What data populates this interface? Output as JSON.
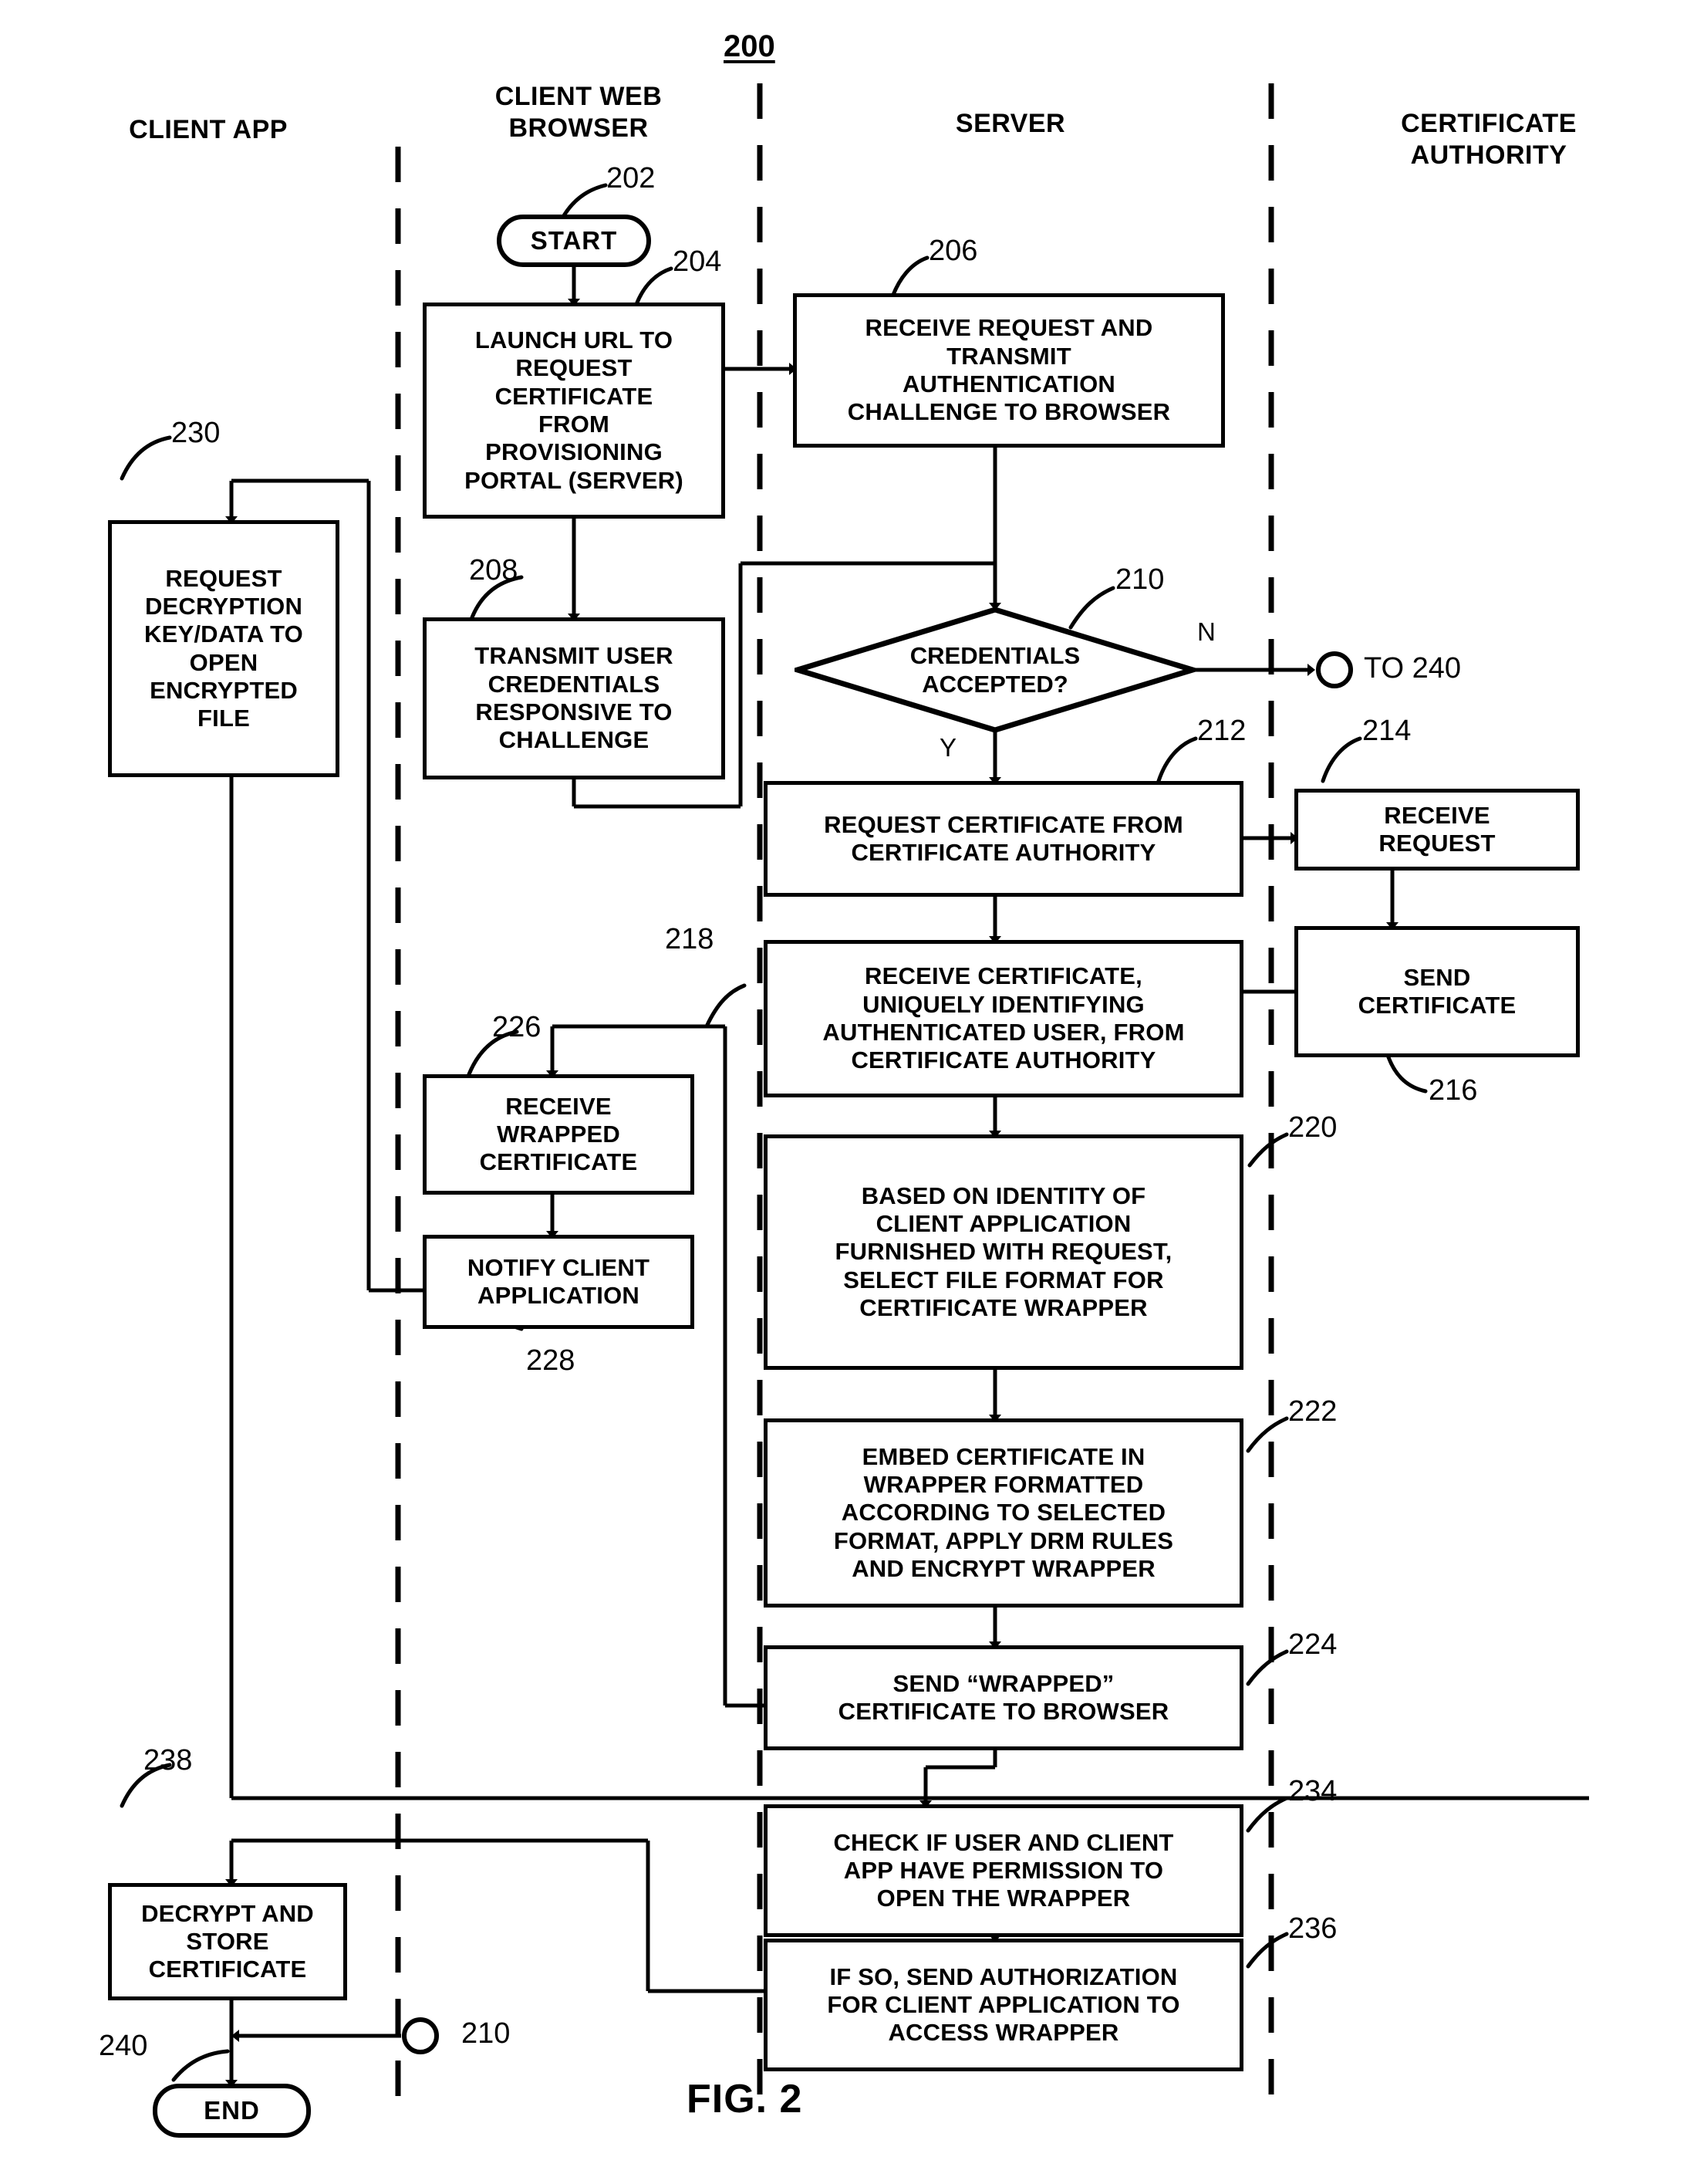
{
  "figure": {
    "number": "200",
    "caption": "FIG. 2"
  },
  "lanes": [
    {
      "id": "client-app",
      "label": "CLIENT APP"
    },
    {
      "id": "client-web-browser",
      "label": "CLIENT WEB\nBROWSER"
    },
    {
      "id": "server",
      "label": "SERVER"
    },
    {
      "id": "certificate-authority",
      "label": "CERTIFICATE\nAUTHORITY"
    }
  ],
  "lane_labels": {
    "client_app": "CLIENT APP",
    "client_web_browser_l1": "CLIENT WEB",
    "client_web_browser_l2": "BROWSER",
    "server": "SERVER",
    "certificate_authority_l1": "CERTIFICATE",
    "certificate_authority_l2": "AUTHORITY"
  },
  "nodes": {
    "n202": {
      "ref": "202",
      "type": "terminator",
      "text": "START",
      "lane": "client-web-browser"
    },
    "n204": {
      "ref": "204",
      "type": "process",
      "text": "LAUNCH URL TO REQUEST CERTIFICATE FROM PROVISIONING PORTAL (SERVER)",
      "lane": "client-web-browser"
    },
    "n206": {
      "ref": "206",
      "type": "process",
      "text": "RECEIVE REQUEST  AND TRANSMIT AUTHENTICATION CHALLENGE TO BROWSER",
      "lane": "server"
    },
    "n208": {
      "ref": "208",
      "type": "process",
      "text": "TRANSMIT USER CREDENTIALS RESPONSIVE TO CHALLENGE",
      "lane": "client-web-browser"
    },
    "n210": {
      "ref": "210",
      "type": "decision",
      "text": "CREDENTIALS ACCEPTED?",
      "lane": "server",
      "yes_label": "Y",
      "no_label": "N"
    },
    "n212": {
      "ref": "212",
      "type": "process",
      "text": "REQUEST CERTIFICATE FROM CERTIFICATE AUTHORITY",
      "lane": "server"
    },
    "n214": {
      "ref": "214",
      "type": "process",
      "text": "RECEIVE REQUEST",
      "lane": "certificate-authority"
    },
    "n216": {
      "ref": "216",
      "type": "process",
      "text": "SEND CERTIFICATE",
      "lane": "certificate-authority"
    },
    "n218": {
      "ref": "218",
      "type": "process",
      "text": "RECEIVE CERTIFICATE, UNIQUELY IDENTIFYING AUTHENTICATED USER, FROM CERTIFICATE AUTHORITY",
      "lane": "server"
    },
    "n220": {
      "ref": "220",
      "type": "process",
      "text": "BASED ON IDENTITY OF CLIENT APPLICATION FURNISHED WITH REQUEST, SELECT FILE FORMAT FOR CERTIFICATE WRAPPER",
      "lane": "server"
    },
    "n222": {
      "ref": "222",
      "type": "process",
      "text": "EMBED CERTIFICATE IN WRAPPER FORMATTED ACCORDING TO SELECTED FORMAT, APPLY DRM RULES AND ENCRYPT WRAPPER",
      "lane": "server"
    },
    "n224": {
      "ref": "224",
      "type": "process",
      "text": "SEND “WRAPPED” CERTIFICATE TO BROWSER",
      "lane": "server"
    },
    "n226": {
      "ref": "226",
      "type": "process",
      "text": "RECEIVE WRAPPED CERTIFICATE",
      "lane": "client-web-browser"
    },
    "n228": {
      "ref": "228",
      "type": "process",
      "text": "NOTIFY CLIENT APPLICATION",
      "lane": "client-web-browser"
    },
    "n230": {
      "ref": "230",
      "type": "process",
      "text": "REQUEST DECRYPTION KEY/DATA TO OPEN ENCRYPTED FILE",
      "lane": "client-app"
    },
    "n234": {
      "ref": "234",
      "type": "process",
      "text": "CHECK IF USER AND CLIENT APP HAVE PERMISSION TO OPEN THE WRAPPER",
      "lane": "server"
    },
    "n236": {
      "ref": "236",
      "type": "process",
      "text": "IF SO, SEND AUTHORIZATION FOR CLIENT APPLICATION TO ACCESS WRAPPER",
      "lane": "server"
    },
    "n238": {
      "ref": "238",
      "type": "process",
      "text": "DECRYPT AND STORE CERTIFICATE",
      "lane": "client-app"
    },
    "n240": {
      "ref": "240",
      "type": "terminator",
      "text": "END",
      "lane": "client-app"
    }
  },
  "box_text_lines": {
    "n204": [
      "LAUNCH URL TO",
      "REQUEST",
      "CERTIFICATE",
      "FROM",
      "PROVISIONING",
      "PORTAL (SERVER)"
    ],
    "n206": [
      "RECEIVE REQUEST  AND",
      "TRANSMIT",
      "AUTHENTICATION",
      "CHALLENGE TO BROWSER"
    ],
    "n208": [
      "TRANSMIT USER",
      "CREDENTIALS",
      "RESPONSIVE TO",
      "CHALLENGE"
    ],
    "n212": [
      "REQUEST CERTIFICATE FROM",
      "CERTIFICATE AUTHORITY"
    ],
    "n214": [
      "RECEIVE",
      "REQUEST"
    ],
    "n216": [
      "SEND",
      "CERTIFICATE"
    ],
    "n218": [
      "RECEIVE CERTIFICATE,",
      "UNIQUELY IDENTIFYING",
      "AUTHENTICATED USER, FROM",
      "CERTIFICATE AUTHORITY"
    ],
    "n220": [
      "BASED ON IDENTITY OF",
      "CLIENT APPLICATION",
      "FURNISHED WITH REQUEST,",
      "SELECT FILE FORMAT FOR",
      "CERTIFICATE WRAPPER"
    ],
    "n222": [
      "EMBED CERTIFICATE IN",
      "WRAPPER FORMATTED",
      "ACCORDING TO SELECTED",
      "FORMAT, APPLY DRM RULES",
      "AND ENCRYPT WRAPPER"
    ],
    "n224": [
      "SEND “WRAPPED”",
      "CERTIFICATE TO BROWSER"
    ],
    "n226": [
      "RECEIVE",
      "WRAPPED",
      "CERTIFICATE"
    ],
    "n228": [
      "NOTIFY CLIENT",
      "APPLICATION"
    ],
    "n230": [
      "REQUEST",
      "DECRYPTION",
      "KEY/DATA TO",
      "OPEN",
      "ENCRYPTED",
      "FILE"
    ],
    "n234": [
      "CHECK IF USER AND CLIENT",
      "APP HAVE PERMISSION TO",
      "OPEN THE WRAPPER"
    ],
    "n236": [
      "IF SO, SEND AUTHORIZATION",
      "FOR CLIENT APPLICATION TO",
      "ACCESS WRAPPER"
    ],
    "n238": [
      "DECRYPT AND",
      "STORE",
      "CERTIFICATE"
    ],
    "n210": [
      "CREDENTIALS",
      "ACCEPTED?"
    ]
  },
  "refnums": {
    "r200": "200",
    "r202": "202",
    "r204": "204",
    "r206": "206",
    "r208": "208",
    "r210_top": "210",
    "r212": "212",
    "r214": "214",
    "r216": "216",
    "r218": "218",
    "r220": "220",
    "r222": "222",
    "r224": "224",
    "r226": "226",
    "r228": "228",
    "r230": "230",
    "r234": "234",
    "r236": "236",
    "r238": "238",
    "r240": "240",
    "r210_bottom": "210"
  },
  "connectors": {
    "no_branch_letter": "N",
    "yes_branch_letter": "Y",
    "to_240_label": "TO 240",
    "from_210_label": "210"
  },
  "colors": {
    "ink": "#000000",
    "paper": "#ffffff"
  }
}
